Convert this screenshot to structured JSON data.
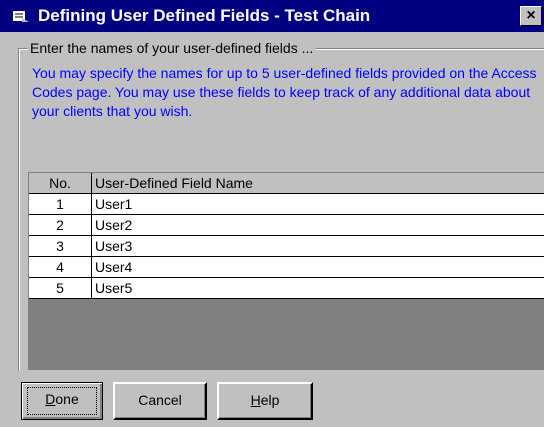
{
  "window": {
    "title": "Defining User Defined Fields - Test Chain",
    "close_label": "×"
  },
  "group": {
    "legend": "Enter the names of your user-defined fields ...",
    "info": "You may specify the names for up to 5 user-defined fields provided on the Access Codes page.  You may use these fields to keep track of any additional data about your clients that you wish."
  },
  "grid": {
    "headers": {
      "no": "No.",
      "name": "User-Defined Field Name"
    },
    "rows": [
      {
        "no": "1",
        "name": "User1"
      },
      {
        "no": "2",
        "name": "User2"
      },
      {
        "no": "3",
        "name": "User3"
      },
      {
        "no": "4",
        "name": "User4"
      },
      {
        "no": "5",
        "name": "User5"
      }
    ]
  },
  "buttons": {
    "done": {
      "label": "Done",
      "accel": "D",
      "rest": "one"
    },
    "cancel": {
      "label": "Cancel"
    },
    "help": {
      "label": "Help",
      "accel": "H",
      "rest": "elp"
    }
  },
  "colors": {
    "titlebar": "#000080",
    "info_text": "#0000ff",
    "face": "#c0c0c0"
  }
}
